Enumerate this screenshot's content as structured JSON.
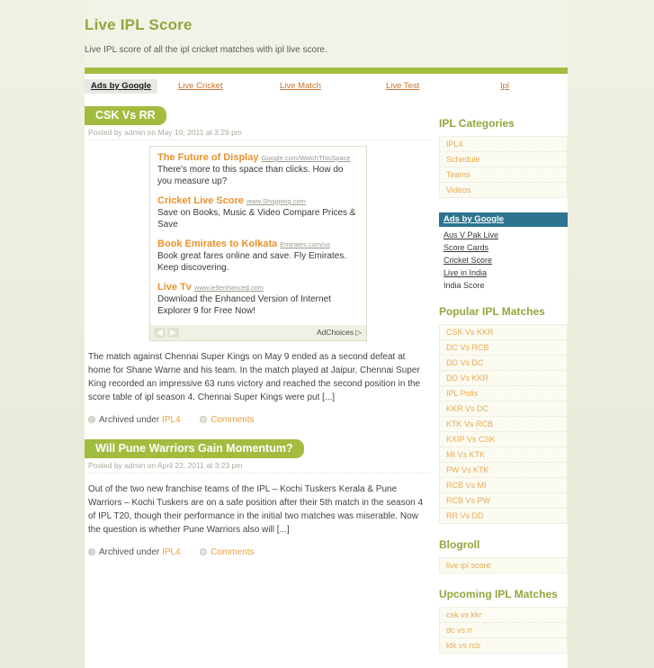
{
  "header": {
    "site_title": "Live IPL Score",
    "site_description": "Live IPL score of all the ipl cricket matches with ipl live score."
  },
  "colors": {
    "accent_green": "#a2bc40",
    "title_green": "#8fa83c",
    "link_orange": "#e8ab52",
    "ad_orange": "#e8922c",
    "ads_blue": "#2d7490",
    "page_bg": "#eaeada"
  },
  "top_ads": {
    "label": "Ads by Google",
    "links": [
      {
        "text": "Live Cricket"
      },
      {
        "text": "Live Match"
      },
      {
        "text": "Live Test"
      },
      {
        "text": "Ipl"
      }
    ]
  },
  "posts": [
    {
      "title": "CSK Vs RR",
      "meta": "Posted by admin on May 10, 2011 at 3:29 pm",
      "body": "The match against Chennai Super Kings on May 9 ended as a second defeat at home for Shane Warne and his team. In the match played at Jaipur, Chennai Super King recorded an impressive 63 runs victory and reached the second position in the score table of ipl season 4. Chennai Super Kings were put [...]",
      "archived_label": "Archived under",
      "category": "IPL4",
      "comments": "Comments"
    },
    {
      "title": "Will Pune Warriors Gain Momentum?",
      "meta": "Posted by admin on April 22, 2011 at 3:23 pm",
      "body": "Out of the two new franchise teams of the IPL – Kochi Tuskers Kerala & Pune Warriors – Kochi Tuskers are on a safe position after their 5th match in the season 4 of IPL T20, though their performance in the initial two matches was miserable. Now the question is whether Pune Warriors also will [...]",
      "archived_label": "Archived under",
      "category": "IPL4",
      "comments": "Comments"
    }
  ],
  "inline_ad": {
    "units": [
      {
        "title": "The Future of Display",
        "url": "Google.com/WatchThisSpace",
        "desc": "There's more to this space than clicks. How do you measure up?"
      },
      {
        "title": "Cricket Live Score",
        "url": "www.Shopping.com",
        "desc": "Save on Books, Music & Video Compare Prices & Save"
      },
      {
        "title": "Book Emirates to Kolkata",
        "url": "Emirates.com/us",
        "desc": "Book great fares online and save. Fly Emirates. Keep discovering."
      },
      {
        "title": "Live Tv",
        "url": "www.ie9enhanced.com",
        "desc": "Download the Enhanced Version of Internet Explorer 9 for Free Now!"
      }
    ],
    "prev_arrow": "◀",
    "next_arrow": "▶",
    "adchoices": "AdChoices ▷"
  },
  "sidebar": {
    "categories": {
      "heading": "IPL Categories",
      "items": [
        {
          "label": "IPL4"
        },
        {
          "label": "Schedule"
        },
        {
          "label": "Teams"
        },
        {
          "label": "Videos"
        }
      ]
    },
    "google_ads": {
      "heading": "Ads by Google",
      "items": [
        {
          "label": "Aus V Pak Live",
          "linked": true
        },
        {
          "label": "Score Cards",
          "linked": true
        },
        {
          "label": "Cricket Score",
          "linked": true
        },
        {
          "label": "Live in India",
          "linked": true
        },
        {
          "label": "India Score",
          "linked": false
        }
      ]
    },
    "popular": {
      "heading": "Popular IPL Matches",
      "items": [
        {
          "label": "CSK Vs KKR"
        },
        {
          "label": "DC Vs RCB"
        },
        {
          "label": "DD Vs DC"
        },
        {
          "label": "DD Vs KKR"
        },
        {
          "label": "IPL Polls"
        },
        {
          "label": "KKR Vs DC"
        },
        {
          "label": "KTK Vs RCB"
        },
        {
          "label": "KXIP Vs CSK"
        },
        {
          "label": "MI Vs KTK"
        },
        {
          "label": "PW Vs KTK"
        },
        {
          "label": "RCB Vs MI"
        },
        {
          "label": "RCB Vs PW"
        },
        {
          "label": "RR Vs DD"
        }
      ]
    },
    "blogroll": {
      "heading": "Blogroll",
      "items": [
        {
          "label": "live ipl score"
        }
      ]
    },
    "upcoming": {
      "heading": "Upcoming IPL Matches",
      "items": [
        {
          "label": "csk vs kkr"
        },
        {
          "label": "dc vs rr"
        },
        {
          "label": "ktk vs rcb"
        }
      ]
    }
  }
}
